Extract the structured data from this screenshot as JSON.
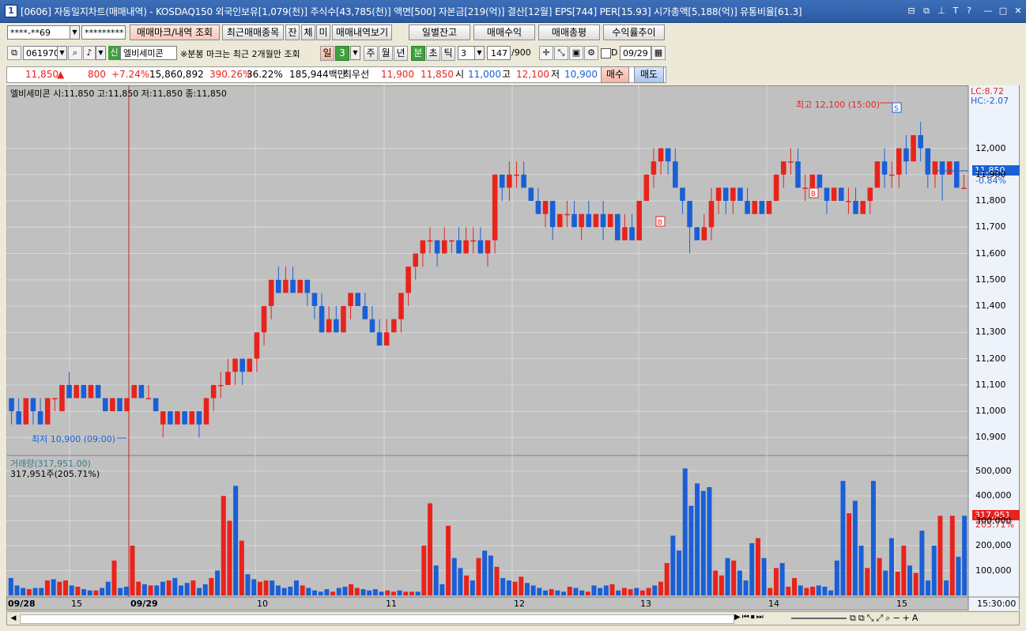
{
  "window": {
    "icon_label": "1",
    "title": "[0606] 자동일지차트(매매내역) - KOSDAQ150 외국인보유[1,079(천)] 주식수[43,785(천)] 액면[500] 자본금[219(억)] 결산[12월] EPS[744] PER[15.93] 시가총액[5,188(억)] 유통비율[61.3]",
    "controls": [
      "⊟",
      "⧉",
      "⊥",
      "T",
      "?",
      "—",
      "□",
      "✕"
    ]
  },
  "toolbar1": {
    "account": "****-**69",
    "password": "*********",
    "btn_mark_query": "매매마크/내역 조회",
    "btn_recent_items": "최근매매종목",
    "btn_jan": "잔",
    "btn_che": "체",
    "btn_mi": "미",
    "btn_view_history": "매매내역보기",
    "btn_daily_balance": "일별잔고",
    "btn_profit": "매매수익",
    "btn_total": "매매총평",
    "btn_return_trend": "수익률추이"
  },
  "toolbar2": {
    "code": "061970",
    "badge_new": "신",
    "stock_name": "엘비세미콘",
    "note": "※분봉 마크는 최근 2개월만 조회",
    "period_day": "일",
    "period_value": "3",
    "period_week": "주",
    "period_month": "월",
    "period_year": "년",
    "period_min": "분",
    "period_sec": "초",
    "period_tick": "틱",
    "interval": "3",
    "count": "147",
    "count_total": "/900",
    "checkbox_label": "D",
    "date": "09/29"
  },
  "quote": {
    "price": "11,850",
    "arrow": "▲",
    "change": "800",
    "change_pct": "+7.24%",
    "volume": "15,860,892",
    "vol_ratio": "390.26%",
    "turnover": "36.22%",
    "amount": "185,944백만",
    "best_label": "최우선",
    "ask": "11,900",
    "bid": "11,850",
    "open_label": "시",
    "open": "11,000",
    "high_label": "고",
    "high": "12,100",
    "low_label": "저",
    "low": "10,900",
    "buy_button": "매수",
    "sell_button": "매도"
  },
  "price_panel": {
    "header": "엘비세미콘 시:11,850 고:11,850 저:11,850 종:11,850",
    "lc": "LC:8.72",
    "hc": "HC:-2.07",
    "high_annotation": "최고 12,100 (15:00)",
    "low_annotation": "최저 10,900 (09:00)",
    "current_price_tag": "11,850",
    "current_pct_tag": "-0.84%",
    "buy_marker": "B",
    "sell_marker": "S",
    "y_ticks": [
      "12,000",
      "11,900",
      "11,800",
      "11,700",
      "11,600",
      "11,500",
      "11,400",
      "11,300",
      "11,200",
      "11,100",
      "11,000",
      "10,900"
    ]
  },
  "volume_panel": {
    "header": "거래량(317,951.00)",
    "sub": "317,951주(205.71%)",
    "current_tag": "317,951",
    "current_pct": "205.71%",
    "y_ticks": [
      "500,000",
      "400,000",
      "300,000",
      "200,000",
      "100,000"
    ]
  },
  "x_axis": {
    "labels": [
      "09/28",
      "15",
      "09/29",
      "10",
      "11",
      "12",
      "13",
      "14",
      "15"
    ],
    "time_label": "15:30:00"
  },
  "colors": {
    "up": "#e8231c",
    "down": "#1a5fd6",
    "chart_bg": "#c0c0c0",
    "title_bar": "#2b5aa4"
  },
  "chart_data": [
    {
      "type": "candlestick",
      "title": "엘비세미콘",
      "ylim": [
        10850,
        12200
      ],
      "candles": [
        [
          11050,
          11050,
          10950,
          11000
        ],
        [
          11000,
          11050,
          10950,
          10950
        ],
        [
          10950,
          11050,
          10950,
          11050
        ],
        [
          11050,
          11050,
          10950,
          11000
        ],
        [
          11000,
          11050,
          10950,
          10950
        ],
        [
          10950,
          11050,
          10950,
          11050
        ],
        [
          11050,
          11050,
          11000,
          11050
        ],
        [
          11000,
          11100,
          11000,
          11100
        ],
        [
          11100,
          11150,
          11050,
          11050
        ],
        [
          11050,
          11100,
          11050,
          11100
        ],
        [
          11100,
          11100,
          11050,
          11050
        ],
        [
          11050,
          11100,
          11050,
          11100
        ],
        [
          11100,
          11100,
          11050,
          11050
        ],
        [
          11050,
          11050,
          11000,
          11000
        ],
        [
          11000,
          11050,
          11000,
          11050
        ],
        [
          11050,
          11050,
          11000,
          11000
        ],
        [
          11000,
          11050,
          11000,
          11050
        ],
        [
          11050,
          11100,
          11050,
          11100
        ],
        [
          11100,
          11100,
          11050,
          11050
        ],
        [
          11050,
          11100,
          11050,
          11050
        ],
        [
          11050,
          11050,
          11000,
          11000
        ],
        [
          10950,
          11000,
          10900,
          11000
        ],
        [
          11000,
          11000,
          10950,
          10950
        ],
        [
          10950,
          11000,
          10950,
          11000
        ],
        [
          11000,
          11000,
          10950,
          10950
        ],
        [
          10950,
          11000,
          10950,
          11000
        ],
        [
          11000,
          11000,
          10900,
          10950
        ],
        [
          10950,
          11050,
          10950,
          11050
        ],
        [
          11050,
          11100,
          11000,
          11100
        ],
        [
          11100,
          11150,
          11050,
          11100
        ],
        [
          11100,
          11200,
          11100,
          11150
        ],
        [
          11150,
          11200,
          11100,
          11200
        ],
        [
          11200,
          11200,
          11100,
          11150
        ],
        [
          11150,
          11200,
          11150,
          11200
        ],
        [
          11200,
          11300,
          11150,
          11300
        ],
        [
          11300,
          11400,
          11250,
          11400
        ],
        [
          11400,
          11500,
          11350,
          11500
        ],
        [
          11500,
          11550,
          11450,
          11450
        ],
        [
          11450,
          11550,
          11450,
          11500
        ],
        [
          11500,
          11550,
          11450,
          11450
        ],
        [
          11450,
          11500,
          11450,
          11500
        ],
        [
          11500,
          11500,
          11400,
          11450
        ],
        [
          11450,
          11450,
          11350,
          11400
        ],
        [
          11400,
          11450,
          11300,
          11300
        ],
        [
          11300,
          11400,
          11300,
          11350
        ],
        [
          11350,
          11400,
          11300,
          11300
        ],
        [
          11300,
          11400,
          11300,
          11400
        ],
        [
          11400,
          11450,
          11350,
          11450
        ],
        [
          11450,
          11450,
          11400,
          11400
        ],
        [
          11400,
          11450,
          11350,
          11350
        ],
        [
          11350,
          11400,
          11300,
          11300
        ],
        [
          11300,
          11350,
          11250,
          11250
        ],
        [
          11250,
          11350,
          11250,
          11300
        ],
        [
          11300,
          11350,
          11300,
          11350
        ],
        [
          11350,
          11450,
          11300,
          11450
        ],
        [
          11450,
          11550,
          11400,
          11550
        ],
        [
          11550,
          11600,
          11500,
          11600
        ],
        [
          11600,
          11650,
          11550,
          11650
        ],
        [
          11650,
          11700,
          11600,
          11650
        ],
        [
          11650,
          11650,
          11550,
          11600
        ],
        [
          11600,
          11700,
          11600,
          11650
        ],
        [
          11650,
          11650,
          11600,
          11650
        ],
        [
          11650,
          11700,
          11600,
          11600
        ],
        [
          11600,
          11700,
          11600,
          11650
        ],
        [
          11650,
          11700,
          11600,
          11650
        ],
        [
          11650,
          11700,
          11600,
          11600
        ],
        [
          11600,
          11650,
          11550,
          11650
        ],
        [
          11650,
          11900,
          11600,
          11900
        ],
        [
          11900,
          11900,
          11800,
          11850
        ],
        [
          11850,
          11950,
          11800,
          11900
        ],
        [
          11900,
          11950,
          11850,
          11900
        ],
        [
          11900,
          11950,
          11850,
          11850
        ],
        [
          11850,
          11850,
          11800,
          11800
        ],
        [
          11800,
          11850,
          11750,
          11750
        ],
        [
          11750,
          11800,
          11700,
          11800
        ],
        [
          11800,
          11800,
          11650,
          11700
        ],
        [
          11700,
          11750,
          11700,
          11750
        ],
        [
          11750,
          11800,
          11700,
          11750
        ],
        [
          11750,
          11800,
          11700,
          11700
        ],
        [
          11700,
          11750,
          11650,
          11750
        ],
        [
          11750,
          11800,
          11700,
          11700
        ],
        [
          11700,
          11750,
          11700,
          11750
        ],
        [
          11750,
          11800,
          11650,
          11700
        ],
        [
          11700,
          11750,
          11700,
          11750
        ],
        [
          11750,
          11750,
          11650,
          11650
        ],
        [
          11650,
          11750,
          11650,
          11700
        ],
        [
          11700,
          11750,
          11650,
          11650
        ],
        [
          11650,
          11800,
          11650,
          11800
        ],
        [
          11800,
          11900,
          11800,
          11900
        ],
        [
          11900,
          12000,
          11850,
          11950
        ],
        [
          11950,
          12000,
          11900,
          12000
        ],
        [
          12000,
          12000,
          11900,
          11950
        ],
        [
          11950,
          12000,
          11850,
          11850
        ],
        [
          11850,
          11850,
          11750,
          11800
        ],
        [
          11800,
          11800,
          11600,
          11700
        ],
        [
          11700,
          11700,
          11650,
          11650
        ],
        [
          11650,
          11750,
          11650,
          11700
        ],
        [
          11700,
          11850,
          11650,
          11800
        ],
        [
          11800,
          11850,
          11750,
          11850
        ],
        [
          11850,
          11850,
          11750,
          11800
        ],
        [
          11800,
          11850,
          11750,
          11850
        ],
        [
          11850,
          11850,
          11800,
          11800
        ],
        [
          11800,
          11850,
          11750,
          11750
        ],
        [
          11750,
          11800,
          11750,
          11800
        ],
        [
          11800,
          11800,
          11750,
          11750
        ],
        [
          11750,
          11800,
          11750,
          11800
        ],
        [
          11800,
          11900,
          11800,
          11900
        ],
        [
          11900,
          11950,
          11850,
          11950
        ],
        [
          11950,
          12000,
          11900,
          11950
        ],
        [
          11950,
          12000,
          11850,
          11850
        ],
        [
          11850,
          11900,
          11800,
          11850
        ],
        [
          11850,
          11900,
          11850,
          11900
        ],
        [
          11900,
          11900,
          11850,
          11850
        ],
        [
          11850,
          11850,
          11750,
          11800
        ],
        [
          11800,
          11850,
          11800,
          11850
        ],
        [
          11850,
          11850,
          11800,
          11800
        ],
        [
          11800,
          11850,
          11750,
          11800
        ],
        [
          11800,
          11850,
          11750,
          11750
        ],
        [
          11750,
          11800,
          11750,
          11800
        ],
        [
          11800,
          11850,
          11750,
          11850
        ],
        [
          11850,
          11950,
          11850,
          11950
        ],
        [
          11950,
          12000,
          11850,
          11900
        ],
        [
          11900,
          11950,
          11850,
          11900
        ],
        [
          11900,
          12000,
          11850,
          12000
        ],
        [
          12000,
          12050,
          11900,
          11950
        ],
        [
          11950,
          12050,
          11950,
          12050
        ],
        [
          12050,
          12100,
          11950,
          12000
        ],
        [
          12000,
          12000,
          11850,
          11900
        ],
        [
          11900,
          11950,
          11850,
          11950
        ],
        [
          11950,
          11950,
          11800,
          11900
        ],
        [
          11900,
          11950,
          11900,
          11950
        ],
        [
          11950,
          11950,
          11850,
          11850
        ],
        [
          11850,
          11900,
          11850,
          11850
        ]
      ]
    },
    {
      "type": "bar",
      "title": "거래량",
      "ylim": [
        0,
        540000
      ],
      "values": [
        70000,
        40000,
        30000,
        25000,
        30000,
        30000,
        60000,
        65000,
        55000,
        60000,
        40000,
        35000,
        25000,
        20000,
        20000,
        30000,
        55000,
        140000,
        30000,
        35000,
        200000,
        55000,
        45000,
        40000,
        40000,
        55000,
        60000,
        70000,
        40000,
        50000,
        60000,
        30000,
        45000,
        70000,
        100000,
        400000,
        300000,
        440000,
        220000,
        85000,
        65000,
        55000,
        60000,
        60000,
        40000,
        30000,
        35000,
        60000,
        40000,
        30000,
        20000,
        15000,
        25000,
        15000,
        30000,
        35000,
        45000,
        30000,
        25000,
        20000,
        25000,
        15000,
        20000,
        15000,
        20000,
        15000,
        15000,
        15000,
        200000,
        370000,
        120000,
        45000,
        280000,
        150000,
        110000,
        80000,
        60000,
        150000,
        180000,
        160000,
        115000,
        70000,
        60000,
        55000,
        75000,
        50000,
        40000,
        30000,
        20000,
        25000,
        20000,
        15000,
        35000,
        30000,
        20000,
        15000,
        40000,
        30000,
        40000,
        45000,
        20000,
        30000,
        25000,
        30000,
        20000,
        30000,
        40000,
        55000,
        130000,
        240000,
        180000,
        510000,
        360000,
        450000,
        420000,
        435000,
        100000,
        80000,
        150000,
        140000,
        100000,
        60000,
        210000,
        230000,
        150000,
        30000,
        110000,
        130000,
        35000,
        70000,
        40000,
        30000,
        35000,
        40000,
        35000,
        20000,
        140000,
        460000,
        330000,
        380000,
        200000,
        110000,
        460000,
        150000,
        100000,
        230000,
        95000,
        200000,
        120000,
        90000,
        260000,
        60000,
        200000,
        320000,
        60000,
        320000,
        155000,
        320000
      ]
    }
  ]
}
